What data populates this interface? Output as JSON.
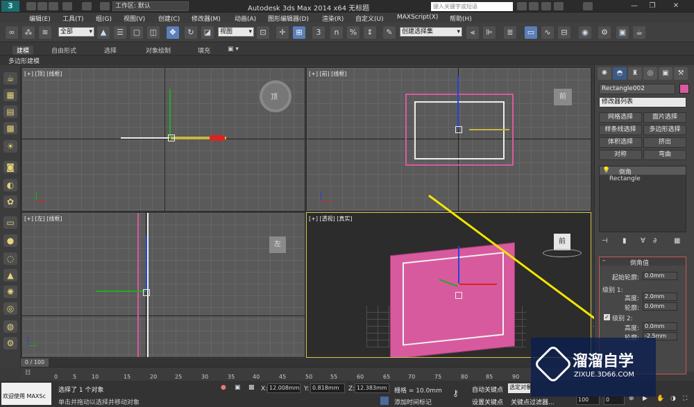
{
  "app": {
    "title": "Autodesk 3ds Max  2014 x64    无标题",
    "workspace": "工作区: 默认",
    "search_placeholder": "键入关键字或短语"
  },
  "menu": [
    "编辑(E)",
    "工具(T)",
    "组(G)",
    "视图(V)",
    "创建(C)",
    "修改器(M)",
    "动画(A)",
    "图形编辑器(D)",
    "渲染(R)",
    "自定义(U)",
    "MAXScript(X)",
    "帮助(H)"
  ],
  "toolbar": {
    "selection_filter": "全部",
    "ref_coord": "视图",
    "named_selection": "创建选择集",
    "snap_label": "3",
    "percent_label": "%",
    "angle_label": "n"
  },
  "ribbon": {
    "tabs": [
      "建模",
      "自由形式",
      "选择",
      "对象绘制",
      "填充"
    ],
    "active": "建模",
    "sub": "多边形建模"
  },
  "viewports": [
    {
      "id": "top",
      "label": "[+] [顶] [线框]"
    },
    {
      "id": "front",
      "label": "[+] [前] [线框]"
    },
    {
      "id": "left",
      "label": "[+] [左] [线框]"
    },
    {
      "id": "persp",
      "label": "[+] [透视] [真实]"
    }
  ],
  "viewcube": {
    "top": "顶",
    "front": "前",
    "left": "左",
    "persp": "前"
  },
  "command_panel": {
    "object_name": "Rectangle002",
    "modifier_list": "修改器列表",
    "modifier_buttons": [
      "网格选择",
      "面片选择",
      "样条线选择",
      "多边形选择",
      "体积选择",
      "挤出",
      "对称",
      "弯曲"
    ],
    "stack": [
      "倒角",
      "Rectangle"
    ],
    "rollout_title": "倒角值",
    "start_outline_label": "起始轮廓:",
    "start_outline": "0.0mm",
    "level1_label": "级别 1:",
    "level1_height_label": "高度:",
    "level1_height": "2.0mm",
    "level1_outline_label": "轮廓:",
    "level1_outline": "0.0mm",
    "level2_label": "级别 2:",
    "level2_height_label": "高度:",
    "level2_height": "0.0mm",
    "level2_outline_label": "轮廓:",
    "level2_outline": "-2.5mm"
  },
  "timeline": {
    "frame_display": "0 / 100",
    "ticks": [
      "0",
      "5",
      "10",
      "15",
      "20",
      "25",
      "30",
      "35",
      "40",
      "45",
      "50",
      "55",
      "60",
      "65",
      "70",
      "75",
      "80",
      "85",
      "90"
    ]
  },
  "status": {
    "maxscript": "欢迎使用 MAXSc",
    "selected": "选择了 1 个对象",
    "prompt": "单击并拖动以选择并移动对象",
    "x_label": "X:",
    "x": "12.008mm",
    "y_label": "Y:",
    "y": "0.818mm",
    "z_label": "Z:",
    "z": "12.383mm",
    "grid": "栅格 = 10.0mm",
    "auto_key": "自动关键点",
    "set_key": "设置关键点",
    "selected_obj": "选定对象",
    "add_time_tag": "添加时间标记",
    "key_filters": "关键点过滤器...",
    "frame": "100",
    "frame_counter": "0"
  },
  "watermark": {
    "brand": "溜溜自学",
    "url": "ZIXUE.3D66.COM"
  },
  "colors": {
    "object_pink": "#d85a9e",
    "selection_box": "#ffffff",
    "arrow": "#f2e600",
    "x_axis": "#d22",
    "y_axis": "#2a2",
    "z_axis": "#24d"
  }
}
